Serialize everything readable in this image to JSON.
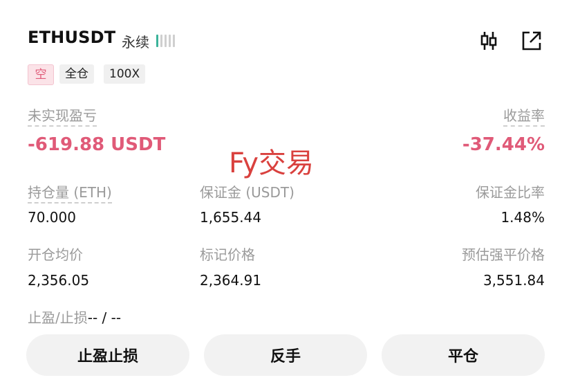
{
  "header": {
    "symbol": "ETHUSDT",
    "contract_type": "永续",
    "leverage_indicator_bars": 5,
    "leverage_indicator_active": 1,
    "icons": [
      "chart-settings-icon",
      "share-icon"
    ]
  },
  "tags": {
    "side": "空",
    "margin_mode": "全仓",
    "leverage": "100X"
  },
  "pnl": {
    "unrealized_label": "未实现盈亏",
    "unrealized_value": "-619.88 USDT",
    "roe_label": "收益率",
    "roe_value": "-37.44%"
  },
  "watermark": "Fy交易",
  "stats": {
    "position_label": "持仓量 (ETH)",
    "position_value": "70.000",
    "margin_label": "保证金 (USDT)",
    "margin_value": "1,655.44",
    "margin_ratio_label": "保证金比率",
    "margin_ratio_value": "1.48%",
    "entry_price_label": "开仓均价",
    "entry_price_value": "2,356.05",
    "mark_price_label": "标记价格",
    "mark_price_value": "2,364.91",
    "liq_price_label": "预估强平价格",
    "liq_price_value": "3,551.84"
  },
  "tpsl": {
    "label": "止盈/止损",
    "value": "-- / --"
  },
  "actions": {
    "tpsl": "止盈止损",
    "reverse": "反手",
    "close": "平仓"
  },
  "colors": {
    "loss": "#e05a78",
    "watermark": "#d9413e",
    "button_bg": "#f2f2f2"
  }
}
